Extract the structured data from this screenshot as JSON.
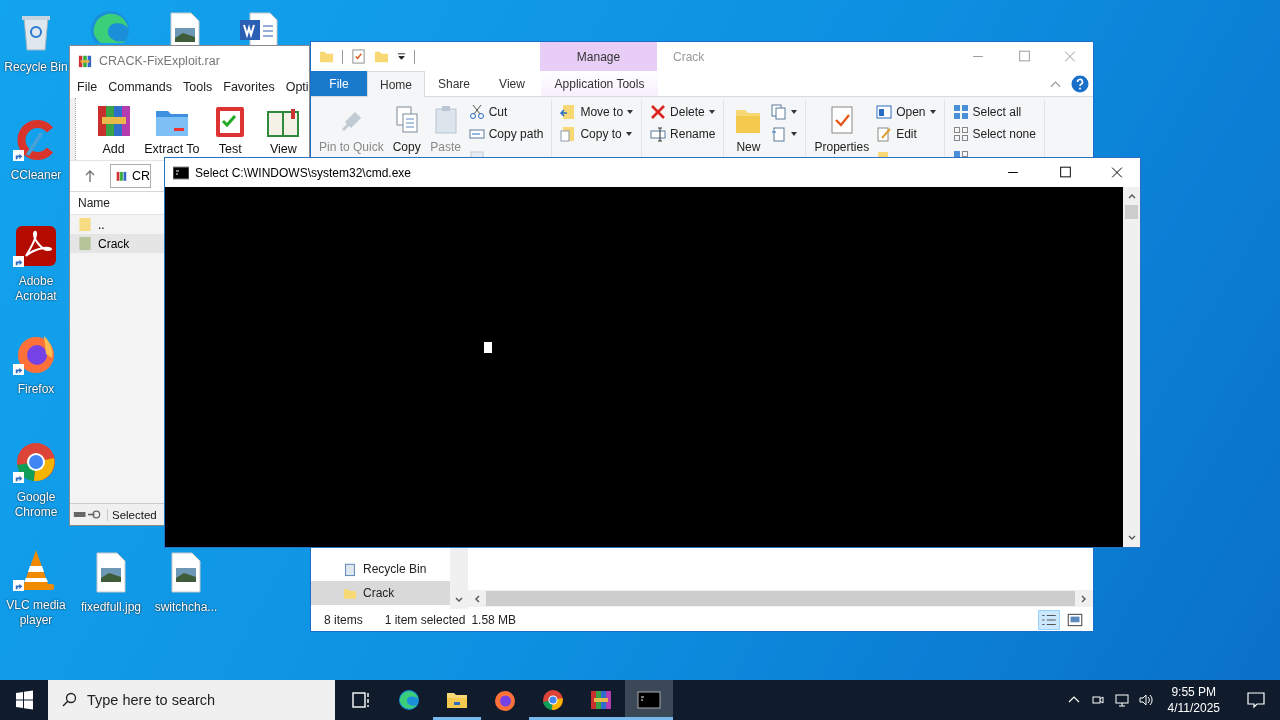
{
  "desktop_icons": [
    {
      "kind": "recycle",
      "label": "Recycle Bin",
      "shortcut": false
    },
    {
      "kind": "edge",
      "shortcut": false
    },
    {
      "kind": "image",
      "shortcut": false
    },
    {
      "kind": "word",
      "shortcut": false
    },
    {
      "kind": "ccleaner",
      "label": "CCleaner",
      "shortcut": true
    },
    {
      "kind": "acrobat",
      "label": "Adobe Acrobat",
      "shortcut": true
    },
    {
      "kind": "firefox",
      "label": "Firefox",
      "shortcut": true
    },
    {
      "kind": "chrome",
      "label": "Google Chrome",
      "shortcut": true
    },
    {
      "kind": "vlc",
      "label": "VLC media player",
      "shortcut": true
    },
    {
      "kind": "image",
      "label": "fixedfull.jpg",
      "shortcut": false
    },
    {
      "kind": "image",
      "label": "switchcha...",
      "shortcut": false
    }
  ],
  "winrar": {
    "title": "CRACK-FixExploit.rar",
    "menu": [
      "File",
      "Commands",
      "Tools",
      "Favorites",
      "Opti"
    ],
    "toolbar": [
      {
        "kind": "add",
        "label": "Add"
      },
      {
        "kind": "extract",
        "label": "Extract To"
      },
      {
        "kind": "test",
        "label": "Test"
      },
      {
        "kind": "view",
        "label": "View"
      }
    ],
    "address": "CR",
    "column": "Name",
    "rows": [
      {
        "kind": "up",
        "name": "..",
        "selected": false
      },
      {
        "kind": "folder",
        "name": "Crack",
        "selected": true
      }
    ],
    "status": "Selected"
  },
  "explorer": {
    "title": "Crack",
    "context_group": "Manage",
    "tabs": [
      {
        "label": "File",
        "kind": "file",
        "selected": false
      },
      {
        "label": "Home",
        "kind": "tab",
        "selected": true
      },
      {
        "label": "Share",
        "kind": "tab",
        "selected": false
      },
      {
        "label": "View",
        "kind": "tab",
        "selected": false
      },
      {
        "label": "Application Tools",
        "kind": "context",
        "selected": false
      }
    ],
    "ribbon": [
      {
        "big": [
          {
            "kind": "pin",
            "label": "Pin to Quick",
            "disabled": true
          },
          {
            "kind": "copy",
            "label": "Copy",
            "disabled": false
          },
          {
            "kind": "paste",
            "label": "Paste",
            "disabled": true
          }
        ],
        "small": [
          {
            "kind": "cut",
            "label": "Cut",
            "disabled": false
          },
          {
            "kind": "copypath",
            "label": "Copy path",
            "disabled": false
          },
          {
            "kind": "shortcut",
            "disabled": true
          }
        ]
      },
      {
        "small": [
          {
            "kind": "move",
            "label": "Move to",
            "dropdown": true,
            "disabled": false
          },
          {
            "kind": "copyto",
            "label": "Copy to",
            "dropdown": true,
            "disabled": false
          }
        ]
      },
      {
        "small": [
          {
            "kind": "delete",
            "label": "Delete",
            "dropdown": true,
            "disabled": false
          },
          {
            "kind": "rename",
            "label": "Rename",
            "disabled": false
          }
        ]
      },
      {
        "big": [
          {
            "kind": "newfolder",
            "label": "New",
            "disabled": false
          }
        ],
        "small": [
          {
            "kind": "newitem",
            "dropdown": true,
            "disabled": false
          },
          {
            "kind": "easy",
            "dropdown": true,
            "disabled": false
          }
        ]
      },
      {
        "big": [
          {
            "kind": "properties",
            "label": "Properties",
            "disabled": false
          }
        ],
        "small": [
          {
            "kind": "open",
            "label": "Open",
            "dropdown": true,
            "disabled": false
          },
          {
            "kind": "edit",
            "label": "Edit",
            "disabled": false
          },
          {
            "kind": "history",
            "disabled": false
          }
        ]
      },
      {
        "small": [
          {
            "kind": "selall",
            "label": "Select all",
            "disabled": false
          },
          {
            "kind": "selnone",
            "label": "Select none",
            "disabled": false
          },
          {
            "kind": "invert",
            "disabled": false
          }
        ]
      }
    ],
    "nav": [
      {
        "kind": "recycle",
        "label": "Recycle Bin",
        "selected": false
      },
      {
        "kind": "folder",
        "label": "Crack",
        "selected": true
      }
    ],
    "status": {
      "items": "8 items",
      "selected": "1 item selected",
      "size": "1.58 MB"
    }
  },
  "cmd": {
    "title": "Select C:\\WINDOWS\\system32\\cmd.exe",
    "cursor": true
  },
  "taskbar": {
    "search_placeholder": "Type here to search",
    "apps": [
      {
        "kind": "taskview",
        "running": false,
        "active": false
      },
      {
        "kind": "edge",
        "running": false,
        "active": false
      },
      {
        "kind": "explorer",
        "running": true,
        "active": false
      },
      {
        "kind": "firefox",
        "running": false,
        "active": false
      },
      {
        "kind": "chrome",
        "running": true,
        "active": false
      },
      {
        "kind": "winrar",
        "running": true,
        "active": false
      },
      {
        "kind": "cmd",
        "running": true,
        "active": true
      }
    ],
    "time": "9:55 PM",
    "date": "4/11/2025"
  }
}
